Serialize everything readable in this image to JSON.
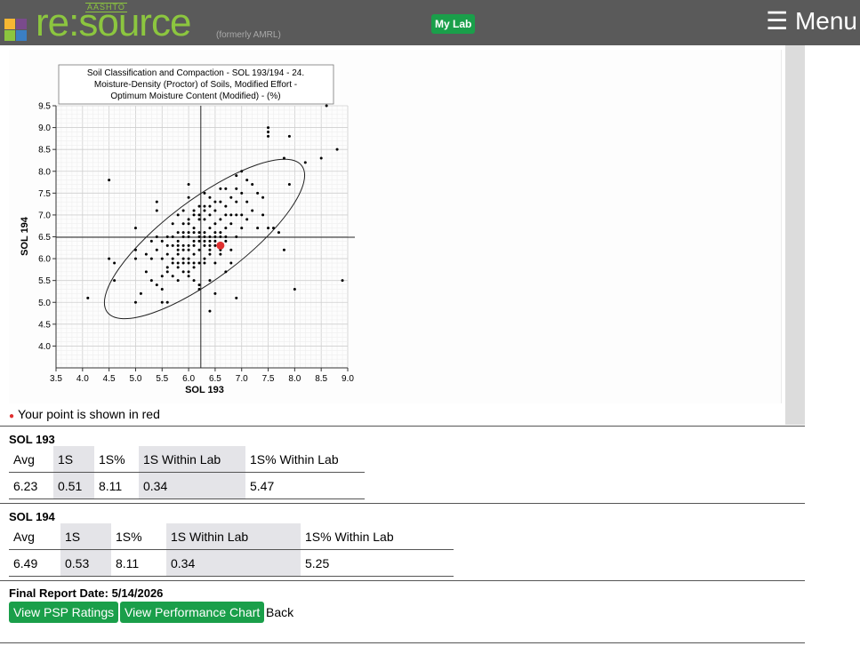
{
  "header": {
    "logo_small": "AASHTO",
    "logo_main": "re:source",
    "logo_formerly": "(formerly AMRL)",
    "mylab_label": "My Lab",
    "menu_label": "☰ Menu"
  },
  "colors": {
    "topbar": "#5a5a5a",
    "brand_green": "#8cc63f",
    "button_green": "#1a9f4a",
    "highlight_red": "#e03030"
  },
  "chart_data": {
    "type": "scatter",
    "title": "Soil Classification and Compaction - SOL 193/194 - 24. Moisture-Density (Proctor) of Soils, Modified Effort - Optimum Moisture Content (Modified) - (%)",
    "title_lines": [
      "Soil Classification and Compaction - SOL 193/194 - 24.",
      "Moisture-Density (Proctor) of Soils, Modified Effort -",
      "Optimum Moisture Content (Modified) - (%)"
    ],
    "xlabel": "SOL 193",
    "ylabel": "SOL 194",
    "xlim": [
      3.5,
      9.0
    ],
    "ylim": [
      3.5,
      9.5
    ],
    "x_ticks": [
      "3.5",
      "4.0",
      "4.5",
      "5.0",
      "5.5",
      "6.0",
      "6.5",
      "7.0",
      "7.5",
      "8.0",
      "8.5",
      "9.0"
    ],
    "y_ticks": [
      "4.0",
      "4.5",
      "5.0",
      "5.5",
      "6.0",
      "6.5",
      "7.0",
      "7.5",
      "8.0",
      "8.5",
      "9.0",
      "9.5"
    ],
    "grid": true,
    "crosshair": {
      "x": 6.23,
      "y": 6.49
    },
    "ellipse": {
      "cx": 6.3,
      "cy": 6.45,
      "rx": 2.8,
      "ry": 0.95,
      "angle_deg": 37
    },
    "your_point": {
      "x": 6.6,
      "y": 6.3
    },
    "points": [
      [
        4.1,
        5.1
      ],
      [
        4.5,
        7.8
      ],
      [
        4.5,
        6.0
      ],
      [
        4.6,
        5.9
      ],
      [
        4.6,
        5.5
      ],
      [
        5.0,
        6.7
      ],
      [
        5.0,
        6.2
      ],
      [
        5.0,
        6.0
      ],
      [
        5.0,
        5.0
      ],
      [
        5.1,
        5.2
      ],
      [
        5.2,
        5.7
      ],
      [
        5.2,
        6.1
      ],
      [
        5.3,
        6.4
      ],
      [
        5.3,
        6.0
      ],
      [
        5.3,
        5.5
      ],
      [
        5.4,
        5.4
      ],
      [
        5.4,
        6.2
      ],
      [
        5.4,
        6.5
      ],
      [
        5.4,
        7.3
      ],
      [
        5.4,
        7.1
      ],
      [
        5.5,
        6.4
      ],
      [
        5.5,
        6.0
      ],
      [
        5.5,
        5.6
      ],
      [
        5.5,
        5.3
      ],
      [
        5.5,
        5.0
      ],
      [
        5.6,
        5.0
      ],
      [
        5.6,
        5.8
      ],
      [
        5.6,
        6.1
      ],
      [
        5.6,
        6.3
      ],
      [
        5.6,
        6.5
      ],
      [
        5.7,
        6.8
      ],
      [
        5.7,
        6.3
      ],
      [
        5.7,
        6.0
      ],
      [
        5.7,
        5.6
      ],
      [
        5.8,
        5.8
      ],
      [
        5.8,
        6.2
      ],
      [
        5.8,
        6.4
      ],
      [
        5.8,
        7.0
      ],
      [
        5.8,
        5.5
      ],
      [
        5.9,
        6.0
      ],
      [
        5.9,
        6.3
      ],
      [
        5.9,
        6.6
      ],
      [
        5.9,
        6.8
      ],
      [
        5.9,
        7.1
      ],
      [
        5.9,
        5.7
      ],
      [
        6.0,
        6.0
      ],
      [
        6.0,
        6.2
      ],
      [
        6.0,
        6.5
      ],
      [
        6.0,
        6.8
      ],
      [
        6.0,
        7.4
      ],
      [
        6.0,
        5.9
      ],
      [
        6.0,
        5.6
      ],
      [
        6.0,
        7.7
      ],
      [
        6.1,
        6.1
      ],
      [
        6.1,
        6.4
      ],
      [
        6.1,
        6.7
      ],
      [
        6.1,
        7.0
      ],
      [
        6.1,
        5.8
      ],
      [
        6.1,
        5.5
      ],
      [
        6.2,
        6.2
      ],
      [
        6.2,
        6.5
      ],
      [
        6.2,
        6.9
      ],
      [
        6.2,
        7.2
      ],
      [
        6.2,
        5.9
      ],
      [
        6.2,
        5.3
      ],
      [
        6.2,
        5.4
      ],
      [
        6.3,
        6.0
      ],
      [
        6.3,
        6.3
      ],
      [
        6.3,
        6.6
      ],
      [
        6.3,
        6.9
      ],
      [
        6.3,
        7.5
      ],
      [
        6.3,
        7.2
      ],
      [
        6.3,
        5.9
      ],
      [
        6.4,
        6.1
      ],
      [
        6.4,
        6.4
      ],
      [
        6.4,
        6.7
      ],
      [
        6.4,
        7.0
      ],
      [
        6.4,
        7.4
      ],
      [
        6.4,
        6.2
      ],
      [
        6.4,
        5.5
      ],
      [
        6.4,
        4.8
      ],
      [
        6.5,
        6.5
      ],
      [
        6.5,
        6.8
      ],
      [
        6.5,
        7.1
      ],
      [
        6.5,
        5.9
      ],
      [
        6.5,
        6.3
      ],
      [
        6.5,
        5.2
      ],
      [
        6.6,
        6.6
      ],
      [
        6.6,
        6.9
      ],
      [
        6.6,
        7.6
      ],
      [
        6.6,
        6.1
      ],
      [
        6.7,
        6.4
      ],
      [
        6.7,
        6.7
      ],
      [
        6.7,
        7.2
      ],
      [
        6.7,
        7.6
      ],
      [
        6.7,
        5.7
      ],
      [
        6.8,
        6.8
      ],
      [
        6.8,
        7.0
      ],
      [
        6.8,
        6.2
      ],
      [
        6.8,
        5.9
      ],
      [
        6.9,
        7.0
      ],
      [
        6.9,
        7.3
      ],
      [
        6.9,
        6.5
      ],
      [
        6.9,
        7.9
      ],
      [
        6.9,
        5.1
      ],
      [
        7.0,
        7.0
      ],
      [
        7.0,
        6.7
      ],
      [
        7.0,
        8.0
      ],
      [
        7.1,
        7.3
      ],
      [
        7.1,
        6.9
      ],
      [
        7.2,
        7.7
      ],
      [
        7.2,
        7.1
      ],
      [
        7.3,
        7.5
      ],
      [
        7.3,
        6.7
      ],
      [
        7.4,
        7.4
      ],
      [
        7.4,
        7.0
      ],
      [
        7.5,
        6.7
      ],
      [
        7.5,
        8.8
      ],
      [
        7.5,
        8.9
      ],
      [
        7.5,
        9.0
      ],
      [
        7.6,
        6.7
      ],
      [
        7.7,
        6.6
      ],
      [
        7.8,
        6.2
      ],
      [
        7.8,
        8.3
      ],
      [
        7.9,
        8.8
      ],
      [
        7.9,
        7.7
      ],
      [
        8.0,
        5.3
      ],
      [
        8.2,
        8.2
      ],
      [
        8.5,
        8.3
      ],
      [
        8.8,
        8.5
      ],
      [
        8.9,
        5.5
      ],
      [
        5.8,
        6.6
      ],
      [
        5.9,
        6.5
      ],
      [
        6.0,
        6.6
      ],
      [
        6.1,
        6.6
      ],
      [
        6.2,
        6.6
      ],
      [
        6.3,
        6.5
      ],
      [
        6.4,
        6.5
      ],
      [
        6.5,
        6.6
      ],
      [
        6.6,
        6.5
      ],
      [
        5.8,
        6.1
      ],
      [
        5.9,
        6.2
      ],
      [
        6.0,
        6.3
      ],
      [
        6.1,
        6.3
      ],
      [
        6.2,
        6.4
      ],
      [
        6.3,
        6.4
      ],
      [
        6.4,
        6.3
      ],
      [
        6.5,
        6.4
      ],
      [
        6.6,
        6.2
      ],
      [
        6.7,
        6.5
      ],
      [
        5.7,
        6.5
      ],
      [
        5.8,
        6.3
      ],
      [
        6.0,
        6.9
      ],
      [
        6.1,
        7.1
      ],
      [
        6.2,
        7.0
      ],
      [
        6.3,
        7.1
      ],
      [
        6.4,
        7.2
      ],
      [
        6.5,
        7.3
      ],
      [
        6.6,
        7.3
      ],
      [
        6.7,
        7.0
      ],
      [
        6.8,
        7.4
      ],
      [
        6.9,
        7.6
      ],
      [
        7.0,
        7.5
      ],
      [
        7.1,
        7.8
      ],
      [
        5.6,
        5.7
      ],
      [
        5.7,
        5.9
      ],
      [
        5.8,
        5.9
      ],
      [
        5.9,
        5.9
      ],
      [
        6.0,
        5.7
      ],
      [
        6.1,
        5.9
      ],
      [
        8.6,
        9.5
      ]
    ]
  },
  "legend_note": "Your point is shown in red",
  "sol193": {
    "title": "SOL 193",
    "headers": [
      "Avg",
      "1S",
      "1S%",
      "1S Within Lab",
      "1S% Within Lab"
    ],
    "values": [
      "6.23",
      "0.51",
      "8.11",
      "0.34",
      "5.47"
    ]
  },
  "sol194": {
    "title": "SOL 194",
    "headers": [
      "Avg",
      "1S",
      "1S%",
      "1S Within Lab",
      "1S% Within Lab"
    ],
    "values": [
      "6.49",
      "0.53",
      "8.11",
      "0.34",
      "5.25"
    ]
  },
  "footer": {
    "final_report": "Final Report Date: 5/14/2026",
    "psp_button": "View PSP Ratings",
    "perf_button": "View Performance Chart",
    "back_link": "Back"
  }
}
